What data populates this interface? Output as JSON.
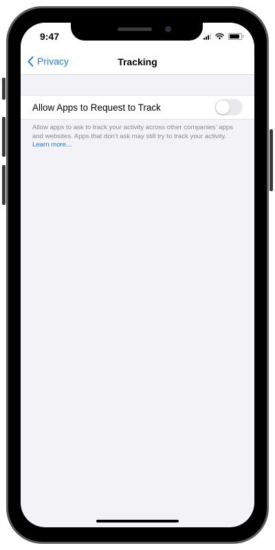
{
  "status_bar": {
    "time": "9:47"
  },
  "nav": {
    "back_label": "Privacy",
    "title": "Tracking"
  },
  "setting": {
    "label": "Allow Apps to Request to Track",
    "toggle_on": false
  },
  "footer": {
    "text": "Allow apps to ask to track your activity across other companies' apps and websites. Apps that don't ask may still try to track your activity.",
    "link": "Learn more..."
  },
  "colors": {
    "accent": "#1a7ee6",
    "background": "#f2f2f7",
    "toggle_off": "#e9e9eb"
  }
}
